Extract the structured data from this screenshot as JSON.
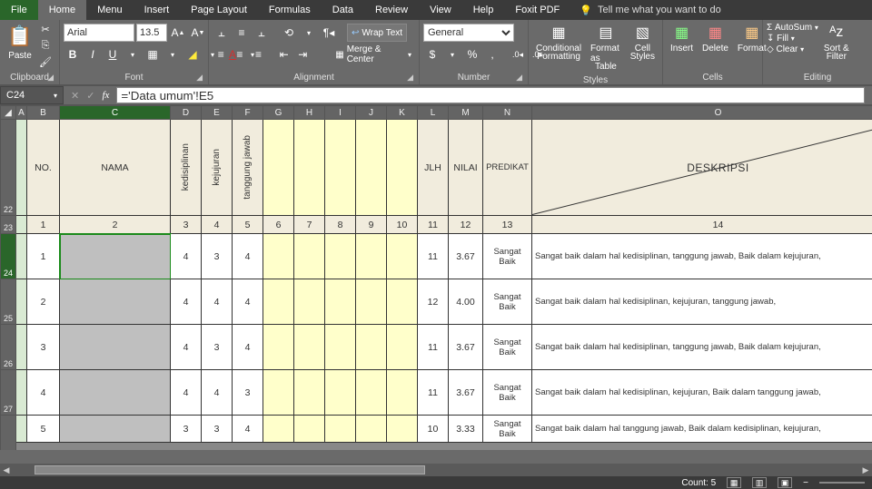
{
  "menu": {
    "file": "File",
    "home": "Home",
    "menu": "Menu",
    "insert": "Insert",
    "page_layout": "Page Layout",
    "formulas": "Formulas",
    "data": "Data",
    "review": "Review",
    "view": "View",
    "help": "Help",
    "foxit": "Foxit PDF",
    "tell": "Tell me what you want to do"
  },
  "ribbon": {
    "paste": "Paste",
    "clipboard": "Clipboard",
    "font_name": "Arial",
    "font_size": "13.5",
    "font": "Font",
    "wrap": "Wrap Text",
    "merge": "Merge & Center",
    "alignment": "Alignment",
    "numfmt": "General",
    "number": "Number",
    "cond": "Conditional",
    "cond2": "Formatting",
    "fat": "Format as",
    "fat2": "Table",
    "cs": "Cell",
    "cs2": "Styles",
    "styles": "Styles",
    "insert": "Insert",
    "delete": "Delete",
    "format": "Format",
    "cells": "Cells",
    "autosum": "AutoSum",
    "fill": "Fill",
    "clear": "Clear",
    "sort": "Sort &",
    "filter": "Filter",
    "editing": "Editing"
  },
  "namebox": "C24",
  "formula": "='Data umum'!E5",
  "cols": {
    "A": "A",
    "B": "B",
    "C": "C",
    "D": "D",
    "E": "E",
    "F": "F",
    "G": "G",
    "H": "H",
    "I": "I",
    "J": "J",
    "K": "K",
    "L": "L",
    "M": "M",
    "N": "N",
    "O": "O"
  },
  "rowlabels": {
    "r22": "22",
    "r23": "23",
    "r24": "24",
    "r25": "25",
    "r26": "26",
    "r27": "27"
  },
  "hdr": {
    "no": "NO.",
    "nama": "NAMA",
    "ked": "kedisiplinan",
    "kej": "kejujuran",
    "tj": "tanggung jawab",
    "jlh": "JLH",
    "nilai": "NILAI",
    "pred": "PREDIKAT",
    "desk": "DESKRIPSI"
  },
  "nums": {
    "n1": "1",
    "n2": "2",
    "n3": "3",
    "n4": "4",
    "n5": "5",
    "n6": "6",
    "n7": "7",
    "n8": "8",
    "n9": "9",
    "n10": "10",
    "n11": "11",
    "n12": "12",
    "n13": "13",
    "n14": "14"
  },
  "rows": [
    {
      "no": "1",
      "d": "4",
      "e": "3",
      "f": "4",
      "jlh": "11",
      "nilai": "3.67",
      "pred": "Sangat Baik",
      "desk": "Sangat baik dalam hal kedisiplinan, tanggung jawab, Baik dalam kejujuran,"
    },
    {
      "no": "2",
      "d": "4",
      "e": "4",
      "f": "4",
      "jlh": "12",
      "nilai": "4.00",
      "pred": "Sangat Baik",
      "desk": "Sangat baik dalam hal kedisiplinan, kejujuran, tanggung jawab,"
    },
    {
      "no": "3",
      "d": "4",
      "e": "3",
      "f": "4",
      "jlh": "11",
      "nilai": "3.67",
      "pred": "Sangat Baik",
      "desk": "Sangat baik dalam hal kedisiplinan, tanggung jawab, Baik dalam kejujuran,"
    },
    {
      "no": "4",
      "d": "4",
      "e": "4",
      "f": "3",
      "jlh": "11",
      "nilai": "3.67",
      "pred": "Sangat Baik",
      "desk": "Sangat baik dalam hal kedisiplinan, kejujuran, Baik dalam tanggung jawab,"
    },
    {
      "no": "5",
      "d": "3",
      "e": "3",
      "f": "4",
      "jlh": "10",
      "nilai": "3.33",
      "pred": "Sangat Baik",
      "desk": "Sangat baik dalam hal tanggung jawab, Baik dalam kedisiplinan, kejujuran,"
    }
  ],
  "status": {
    "count": "Count: 5"
  }
}
